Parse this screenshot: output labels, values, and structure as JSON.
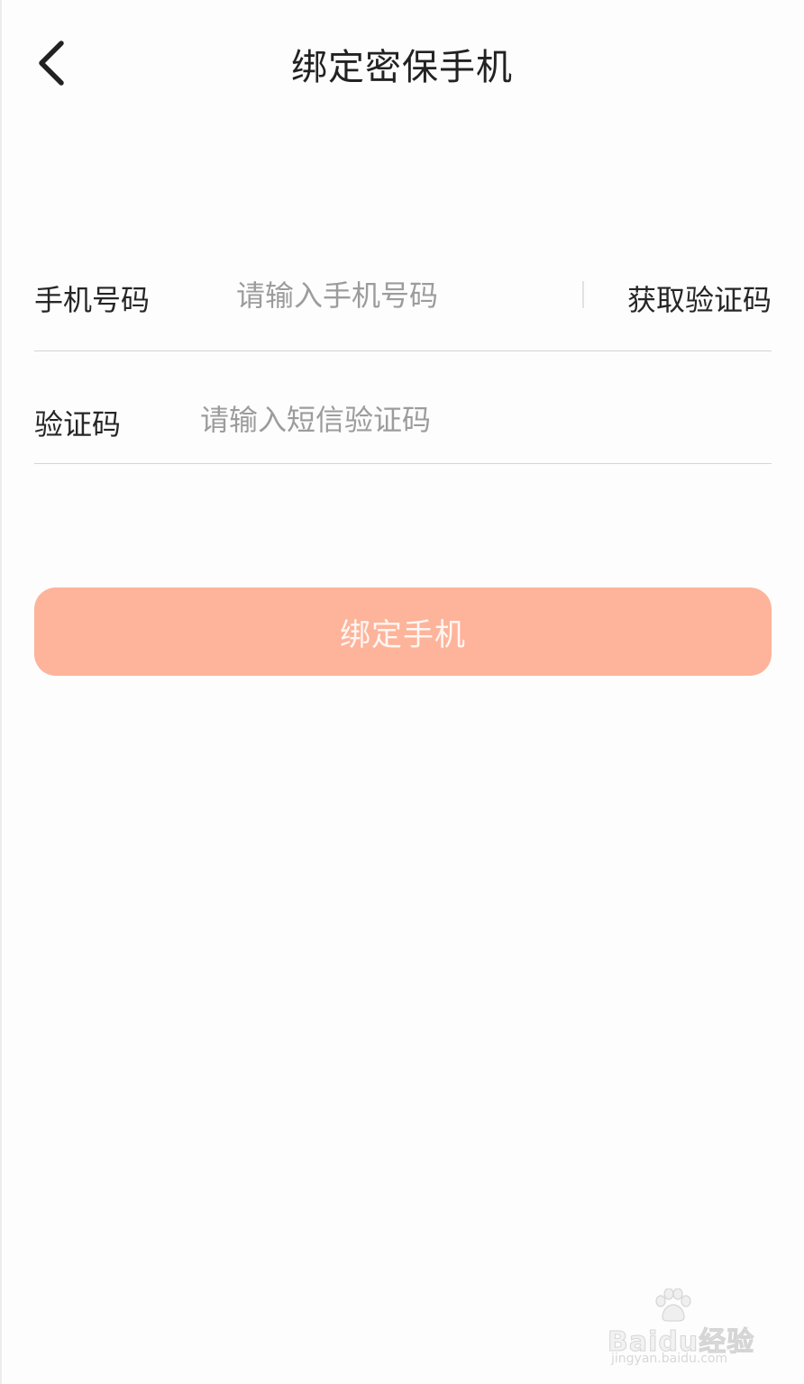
{
  "nav": {
    "back_icon": "chevron-left-icon",
    "title": "绑定密保手机"
  },
  "form": {
    "phone": {
      "label": "手机号码",
      "placeholder": "请输入手机号码",
      "value": "",
      "get_code_label": "获取验证码"
    },
    "code": {
      "label": "验证码",
      "placeholder": "请输入短信验证码",
      "value": ""
    }
  },
  "bind_button": {
    "label": "绑定手机",
    "color": "#fdb49b"
  },
  "watermark": {
    "brand": "Baidu经验",
    "url": "jingyan.baidu.com"
  }
}
